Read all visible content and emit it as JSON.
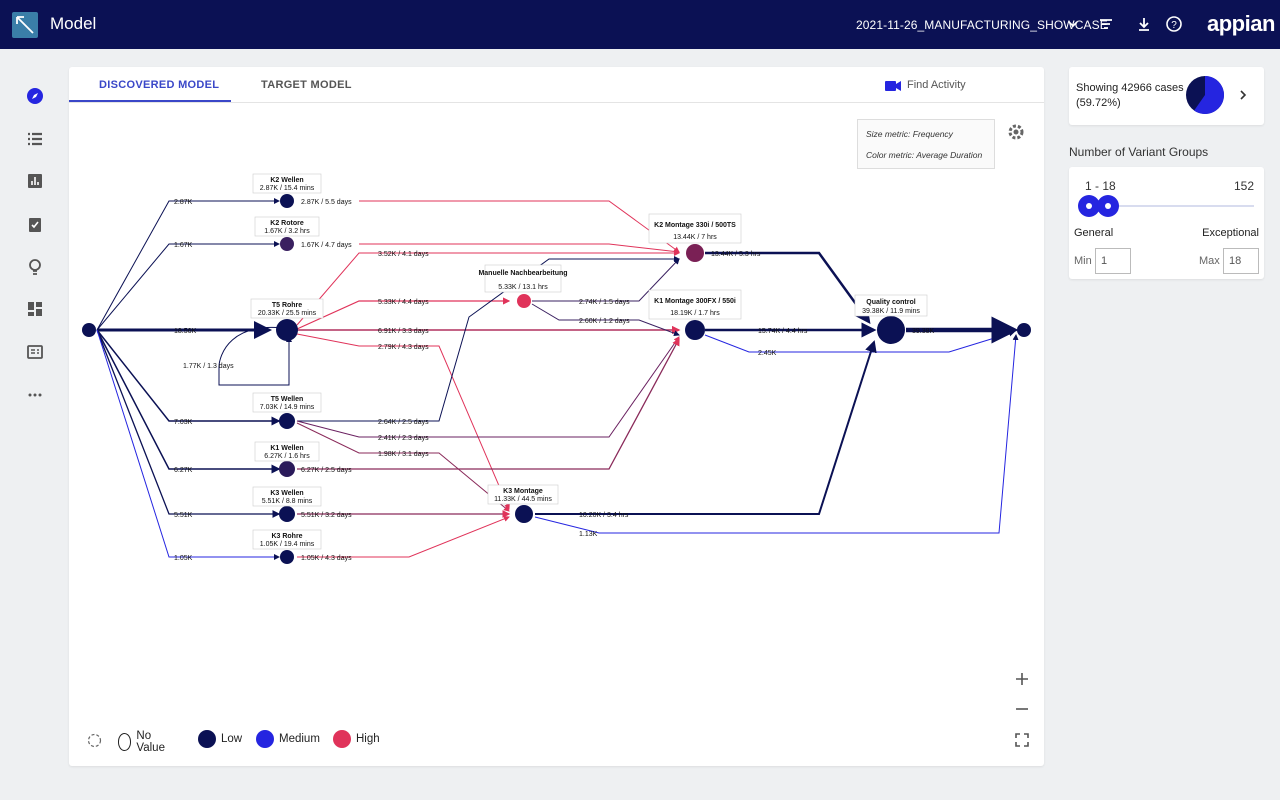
{
  "header": {
    "app_title": "Model",
    "dataset": "2021-11-26_MANUFACTURING_SHOWCASE",
    "brand": "appian"
  },
  "sidebar": {
    "items": [
      "compass-icon",
      "list-icon",
      "bar-chart-icon",
      "clipboard-check-icon",
      "lightbulb-icon",
      "dashboard-icon",
      "report-icon",
      "more-icon"
    ]
  },
  "tabs": {
    "discovered": "DISCOVERED MODEL",
    "target": "TARGET MODEL"
  },
  "find_activity": "Find Activity",
  "metrics": {
    "size": "Size metric: Frequency",
    "color": "Color metric: Average Duration"
  },
  "legend": {
    "no_value": "No Value",
    "low": "Low",
    "medium": "Medium",
    "high": "High",
    "colors": {
      "low": "#0b1154",
      "medium": "#2525e0",
      "high": "#e0335a"
    }
  },
  "summary": {
    "showing": "Showing 42966 cases (59.72%)",
    "pie_fraction": 0.5972
  },
  "variant_groups": {
    "title": "Number of Variant Groups",
    "range": "1 - 18",
    "max_total": "152",
    "general": "General",
    "exceptional": "Exceptional",
    "min_label": "Min",
    "max_label": "Max",
    "min_value": "1",
    "max_value": "18"
  },
  "graph": {
    "nodes": [
      {
        "id": "start",
        "title": "",
        "label": ""
      },
      {
        "id": "k2w",
        "title": "K2 Wellen",
        "label": "2.87K / 15.4 mins"
      },
      {
        "id": "k2r",
        "title": "K2 Rotore",
        "label": "1.67K / 3.2 hrs"
      },
      {
        "id": "t5r",
        "title": "T5 Rohre",
        "label": "20.33K / 25.5 mins"
      },
      {
        "id": "t5w",
        "title": "T5 Wellen",
        "label": "7.03K / 14.9 mins"
      },
      {
        "id": "k1w",
        "title": "K1 Wellen",
        "label": "6.27K / 1.6 hrs"
      },
      {
        "id": "k3w",
        "title": "K3 Wellen",
        "label": "5.51K / 8.8 mins"
      },
      {
        "id": "k3r",
        "title": "K3 Rohre",
        "label": "1.05K / 19.4 mins"
      },
      {
        "id": "mn",
        "title": "Manuelle Nachbearbeitung",
        "label": "5.33K / 13.1 hrs"
      },
      {
        "id": "k3m",
        "title": "K3 Montage",
        "label": "11.33K / 44.5 mins"
      },
      {
        "id": "k2m",
        "title": "K2 Montage 330i / 500TS",
        "label": "13.44K / 7 hrs"
      },
      {
        "id": "k1m",
        "title": "K1 Montage 300FX / 550i",
        "label": "18.19K / 1.7 hrs"
      },
      {
        "id": "qc",
        "title": "Quality control",
        "label": "39.38K / 11.9 mins"
      },
      {
        "id": "end",
        "title": "",
        "label": ""
      }
    ],
    "edge_labels": {
      "s_k2w": "2.87K",
      "s_k2r": "1.67K",
      "s_t5r": "18.56K",
      "s_t5w": "7.03K",
      "s_k1w": "6.27K",
      "s_k3w": "5.51K",
      "s_k3r": "1.05K",
      "k2w_k2m": "2.87K / 5.5 days",
      "k2r_k2m": "1.67K / 4.7 days",
      "t5r_k2m": "3.52K / 4.1 days",
      "t5r_mn": "5.33K / 4.4 days",
      "t5r_k1m": "6.91K / 3.3 days",
      "t5r_k3m": "2.79K / 4.3 days",
      "t5r_loop": "1.77K / 1.3 days",
      "mn_k2m": "2.74K / 1.5 days",
      "mn_k1m": "2.60K / 1.2 days",
      "t5w_a": "2.64K / 2.5 days",
      "t5w_b": "2.41K / 2.3 days",
      "t5w_c": "1.98K / 3.1 days",
      "k1w_k1m": "6.27K / 2.5 days",
      "k3w_k3m": "5.51K / 3.2 days",
      "k3r_k3m": "1.05K / 4.3 days",
      "k2m_qc": "13.44K / 5.3 hrs",
      "k1m_qc": "15.74K / 4.4 hrs",
      "k1m_end": "2.45K",
      "k3m_qc": "10.20K / 3.4 hrs",
      "k3m_end": "1.13K",
      "qc_end": "39.38K"
    }
  }
}
